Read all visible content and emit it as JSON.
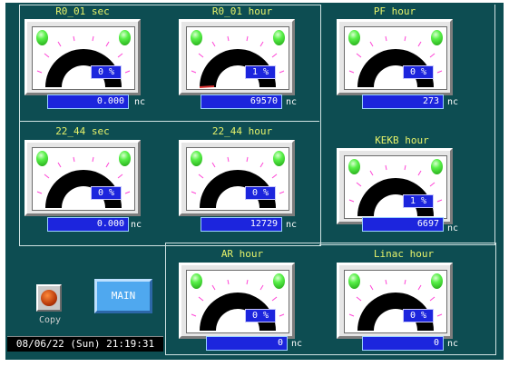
{
  "colors": {
    "screen": "#0d4d52",
    "title": "#e6f26a",
    "gauge_arc": "#000000",
    "tick": "#ff44d6",
    "value_box": "#1c25dd",
    "lamp": "#3ee030"
  },
  "gauges": [
    {
      "title": "R0_01 sec",
      "percent": "0 %",
      "value": "0.000",
      "unit": "nc"
    },
    {
      "title": "R0_01 hour",
      "percent": "1 %",
      "value": "69570",
      "unit": "nc"
    },
    {
      "title": "PF hour",
      "percent": "0 %",
      "value": "273",
      "unit": "nc"
    },
    {
      "title": "22_44 sec",
      "percent": "0 %",
      "value": "0.000",
      "unit": "nc"
    },
    {
      "title": "22_44 hour",
      "percent": "0 %",
      "value": "12729",
      "unit": "nc"
    },
    {
      "title": "KEKB hour",
      "percent": "1 %",
      "value": "6697",
      "unit": "nc"
    },
    {
      "title": "AR hour",
      "percent": "0 %",
      "value": "0",
      "unit": "nc"
    },
    {
      "title": "Linac hour",
      "percent": "0 %",
      "value": "0",
      "unit": "nc"
    }
  ],
  "controls": {
    "copy_label": "Copy",
    "main_label": "MAIN"
  },
  "status": {
    "datetime": "08/06/22 (Sun) 21:19:31"
  }
}
